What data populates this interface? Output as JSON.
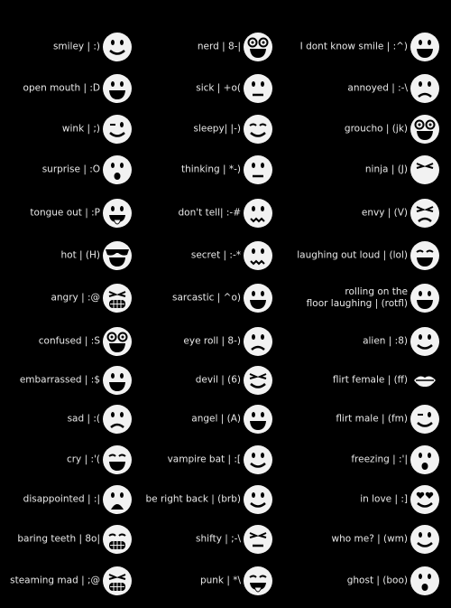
{
  "colors": {
    "background": "#000000",
    "text": "#e8e8e8",
    "icon": "#f2f2f2"
  },
  "columns": [
    [
      {
        "label": "smiley | :)",
        "icon": "smiley-icon",
        "mouth": "smile"
      },
      {
        "label": "open mouth | :D",
        "icon": "open-mouth-icon",
        "mouth": "open"
      },
      {
        "label": "wink | ;)",
        "icon": "wink-icon",
        "mouth": "smile",
        "eyes": "wink"
      },
      {
        "label": "surprise | :O",
        "icon": "surprise-icon",
        "mouth": "o"
      },
      {
        "label": "tongue out | :P",
        "icon": "tongue-out-icon",
        "mouth": "tongue"
      },
      {
        "label": "hot | (H)",
        "icon": "sunglasses-icon",
        "mouth": "open",
        "eyes": "shades"
      },
      {
        "label": "angry | :@",
        "icon": "angry-icon",
        "mouth": "teeth",
        "eyes": "angry"
      },
      {
        "label": "confused | :S",
        "icon": "confused-icon",
        "mouth": "open",
        "eyes": "swirl"
      },
      {
        "label": "embarrassed | :$",
        "icon": "embarrassed-icon",
        "mouth": "open"
      },
      {
        "label": "sad | :(",
        "icon": "sad-icon",
        "mouth": "frown"
      },
      {
        "label": "cry | :'(",
        "icon": "cry-icon",
        "mouth": "open",
        "eyes": "closed"
      },
      {
        "label": "disappointed | :|",
        "icon": "disappointed-icon",
        "mouth": "openfrown"
      },
      {
        "label": "baring teeth | 8o|",
        "icon": "baring-teeth-icon",
        "mouth": "teeth",
        "eyes": "closed"
      },
      {
        "label": "steaming mad | ;@",
        "icon": "steaming-mad-icon",
        "mouth": "teeth",
        "eyes": "angry"
      }
    ],
    [
      {
        "label": "nerd | 8-|",
        "icon": "nerd-icon",
        "mouth": "open",
        "eyes": "glasses"
      },
      {
        "label": "sick | +o(",
        "icon": "sick-icon",
        "mouth": "line"
      },
      {
        "label": "sleepy| |-)",
        "icon": "sleepy-icon",
        "mouth": "smile",
        "eyes": "closed"
      },
      {
        "label": "thinking | *-)",
        "icon": "thinking-icon",
        "mouth": "line"
      },
      {
        "label": "don't tell| :-#",
        "icon": "dont-tell-icon",
        "mouth": "zip"
      },
      {
        "label": "secret | :-*",
        "icon": "secret-icon",
        "mouth": "zip"
      },
      {
        "label": "sarcastic | ^o)",
        "icon": "sarcastic-icon",
        "mouth": "open"
      },
      {
        "label": "eye roll | 8-)",
        "icon": "eye-roll-icon",
        "mouth": "frown"
      },
      {
        "label": "devil | (6)",
        "icon": "devil-icon",
        "mouth": "smile",
        "eyes": "angry"
      },
      {
        "label": "angel | (A)",
        "icon": "angel-icon",
        "mouth": "open"
      },
      {
        "label": "vampire bat | :[",
        "icon": "vampire-bat-icon",
        "mouth": "smile"
      },
      {
        "label": "be right back | (brb)",
        "icon": "be-right-back-icon",
        "mouth": "smile"
      },
      {
        "label": "shifty | ;-\\",
        "icon": "shifty-icon",
        "mouth": "line",
        "eyes": "angry"
      },
      {
        "label": "punk | *\\",
        "icon": "punk-icon",
        "mouth": "tongue",
        "eyes": "closed"
      }
    ],
    [
      {
        "label": "I dont know smile | :^)",
        "icon": "dont-know-smile-icon",
        "mouth": "open"
      },
      {
        "label": "annoyed | :-\\",
        "icon": "annoyed-icon",
        "mouth": "frown"
      },
      {
        "label": "groucho | (jk)",
        "icon": "groucho-icon",
        "mouth": "open",
        "eyes": "glasses"
      },
      {
        "label": "ninja | (J)",
        "icon": "ninja-icon",
        "mouth": "none",
        "eyes": "angry"
      },
      {
        "label": "envy | (V)",
        "icon": "envy-icon",
        "mouth": "frown",
        "eyes": "angry"
      },
      {
        "label": "laughing out loud | (lol)",
        "icon": "laughing-icon",
        "mouth": "open",
        "eyes": "closed"
      },
      {
        "label": "rolling on the floor laughing | (rotfl)",
        "label_line1": "rolling on the",
        "label_line2": "floor laughing | (rotfl)",
        "icon": "rotfl-icon",
        "mouth": "open"
      },
      {
        "label": "alien | :8)",
        "icon": "alien-icon",
        "mouth": "smile"
      },
      {
        "label": "flirt female | (ff)",
        "icon": "lips-icon",
        "mouth": "lips"
      },
      {
        "label": "flirt male | (fm)",
        "icon": "flirt-male-icon",
        "mouth": "smile",
        "eyes": "wink"
      },
      {
        "label": "freezing | :'|",
        "icon": "freezing-icon",
        "mouth": "o"
      },
      {
        "label": "in love | :]",
        "icon": "in-love-icon",
        "mouth": "smile",
        "eyes": "hearts"
      },
      {
        "label": "who me? | (wm)",
        "icon": "who-me-icon",
        "mouth": "smile"
      },
      {
        "label": "ghost | (boo)",
        "icon": "ghost-icon",
        "mouth": "o"
      }
    ]
  ]
}
